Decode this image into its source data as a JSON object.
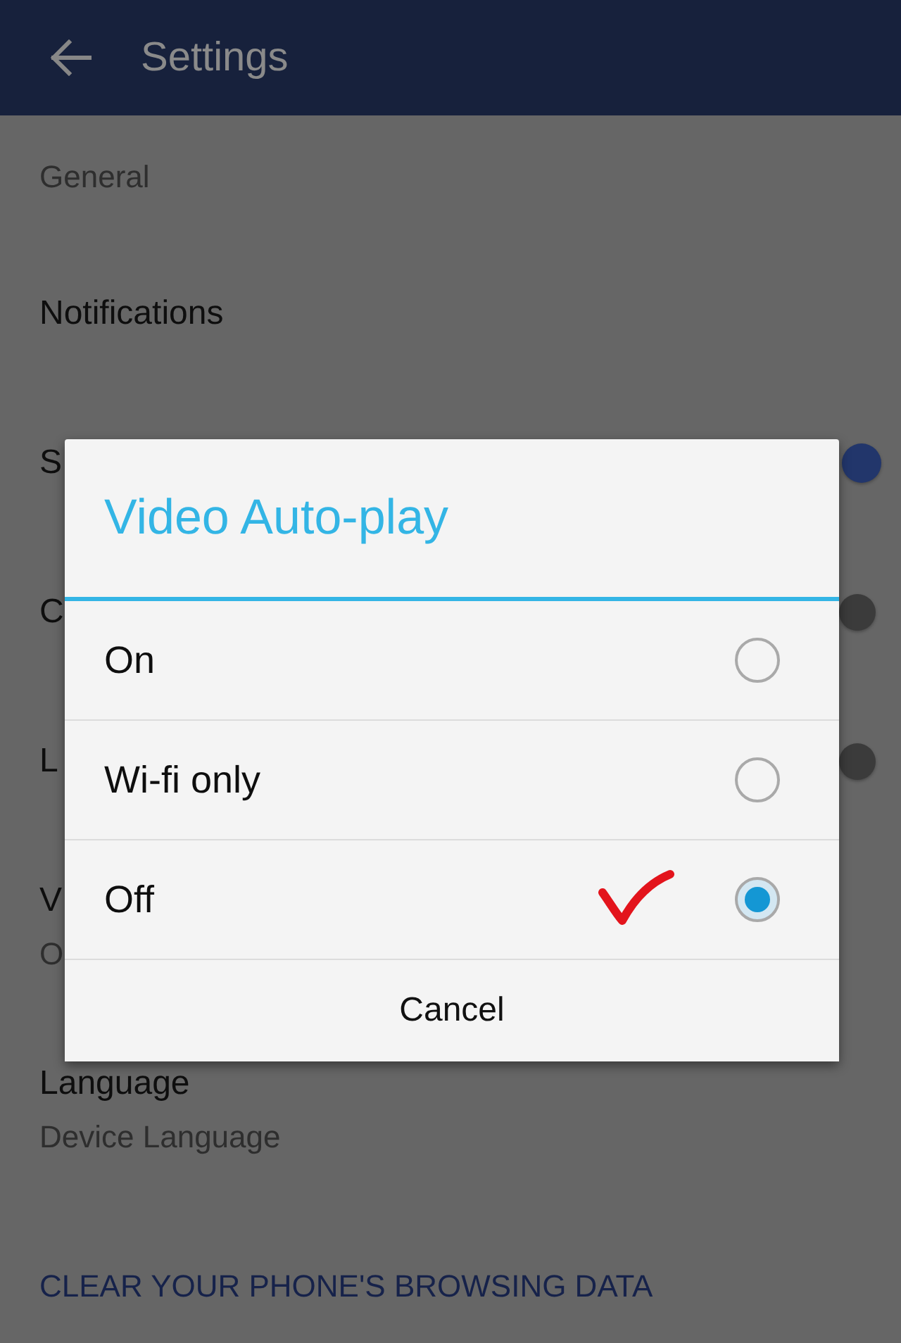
{
  "app_bar": {
    "title": "Settings"
  },
  "settings": {
    "section_header": "General",
    "items": [
      {
        "kind": "plain",
        "title": "Notifications"
      },
      {
        "kind": "toggle",
        "title": "S",
        "on": true
      },
      {
        "kind": "toggle",
        "title": "C",
        "on": false
      },
      {
        "kind": "toggle",
        "title": "L",
        "on": false
      },
      {
        "kind": "detail",
        "title": "V",
        "subtitle": "O"
      },
      {
        "kind": "detail",
        "title": "Language",
        "subtitle": "Device Language"
      },
      {
        "kind": "link",
        "title": "CLEAR YOUR PHONE'S BROWSING DATA"
      }
    ]
  },
  "dialog": {
    "title": "Video Auto-play",
    "options": [
      {
        "label": "On",
        "selected": false,
        "marked": false
      },
      {
        "label": "Wi-fi only",
        "selected": false,
        "marked": false
      },
      {
        "label": "Off",
        "selected": true,
        "marked": true
      }
    ],
    "buttons": [
      "Cancel"
    ]
  }
}
